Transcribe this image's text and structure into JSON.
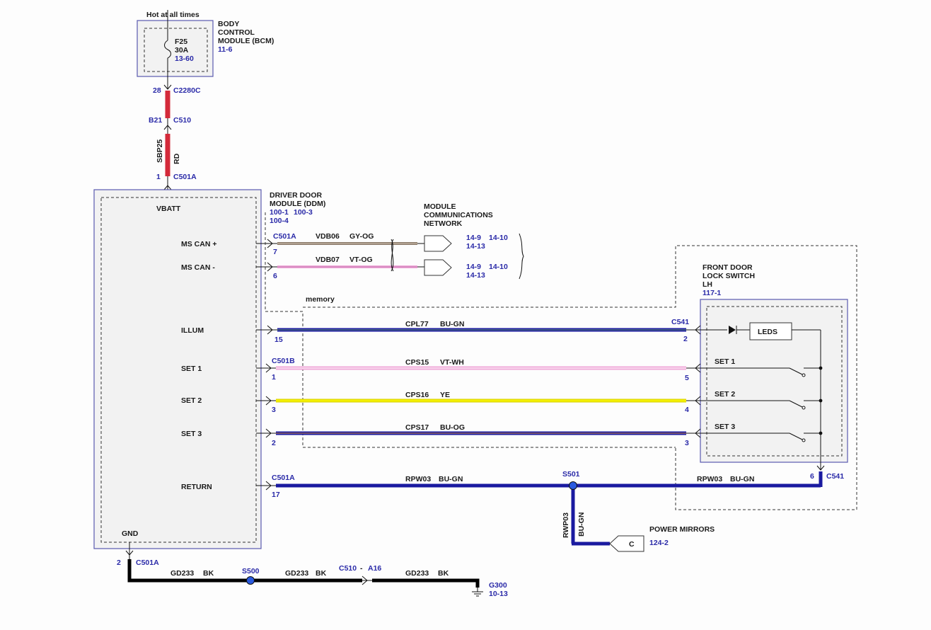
{
  "bcm": {
    "hot_label": "Hot at all times",
    "title_lines": [
      "BODY",
      "CONTROL",
      "MODULE (BCM)"
    ],
    "ref": "11-6",
    "fuse_name": "F25",
    "fuse_rating": "30A",
    "fuse_ref": "13-60"
  },
  "power_feed": {
    "pin_bcm": "28",
    "conn_bcm": "C2280C",
    "pin_c510": "B21",
    "conn_c510": "C510",
    "circuit": "SBP25",
    "color": "RD",
    "pin_ddm": "1",
    "conn_ddm": "C501A"
  },
  "ddm": {
    "title_lines": [
      "DRIVER DOOR",
      "MODULE (DDM)"
    ],
    "refs_line1": [
      "100-1",
      "100-3"
    ],
    "refs_line2": [
      "100-4"
    ],
    "vbatt": "VBATT",
    "gnd": "GND",
    "pins": {
      "ms_can_plus": "MS CAN +",
      "ms_can_minus": "MS CAN -",
      "illum": "ILLUM",
      "set1": "SET 1",
      "set2": "SET 2",
      "set3": "SET 3",
      "return": "RETURN"
    }
  },
  "network": {
    "title_lines": [
      "MODULE",
      "COMMUNICATIONS",
      "NETWORK"
    ],
    "can_plus": {
      "conn": "C501A",
      "pin": "7",
      "circuit": "VDB06",
      "color": "GY-OG",
      "refs": [
        "14-9",
        "14-10",
        "14-13"
      ]
    },
    "can_minus": {
      "pin": "6",
      "circuit": "VDB07",
      "color": "VT-OG",
      "refs": [
        "14-9",
        "14-10",
        "14-13"
      ]
    }
  },
  "memory_label": "memory",
  "switch": {
    "title_lines": [
      "FRONT DOOR",
      "LOCK SWITCH",
      "LH"
    ],
    "ref": "117-1",
    "leds": "LEDS",
    "set1": "SET 1",
    "set2": "SET 2",
    "set3": "SET 3",
    "conn": "C541",
    "return_pin": "6"
  },
  "wires": {
    "illum": {
      "ddm_pin": "15",
      "circuit": "CPL77",
      "color": "BU-GN",
      "sw_conn": "C541",
      "sw_pin": "2"
    },
    "set1": {
      "ddm_conn": "C501B",
      "ddm_pin": "1",
      "circuit": "CPS15",
      "color": "VT-WH",
      "sw_pin": "5"
    },
    "set2": {
      "ddm_pin": "3",
      "circuit": "CPS16",
      "color": "YE",
      "sw_pin": "4"
    },
    "set3": {
      "ddm_pin": "2",
      "circuit": "CPS17",
      "color": "BU-OG",
      "sw_pin": "3"
    },
    "return": {
      "ddm_conn": "C501A",
      "ddm_pin": "17",
      "circuit": "RPW03",
      "color": "BU-GN",
      "splice": "S501",
      "circuit_right": "RPW03",
      "color_right": "BU-GN"
    }
  },
  "mirrors": {
    "circuit": "RWP03",
    "color": "BU-GN",
    "connector": "C",
    "title": "POWER MIRRORS",
    "ref": "124-2"
  },
  "ground": {
    "pin": "2",
    "conn": "C501A",
    "circuit1": "GD233",
    "color1": "BK",
    "splice": "S500",
    "circuit2": "GD233",
    "color2": "BK",
    "inline_conn": "C510",
    "inline_dash": "-",
    "inline_pin": "A16",
    "circuit3": "GD233",
    "color3": "BK",
    "ground_id": "G300",
    "ground_ref": "10-13"
  },
  "colors": {
    "blue_wire": "#1a1aa0",
    "red_wire": "#d42a3a",
    "pink_wire": "#f0a8d8",
    "yellow_wire": "#f4f000",
    "brown_wire": "#8a7a6a",
    "black_wire": "#000000",
    "label_blue": "#2a2aa8"
  }
}
